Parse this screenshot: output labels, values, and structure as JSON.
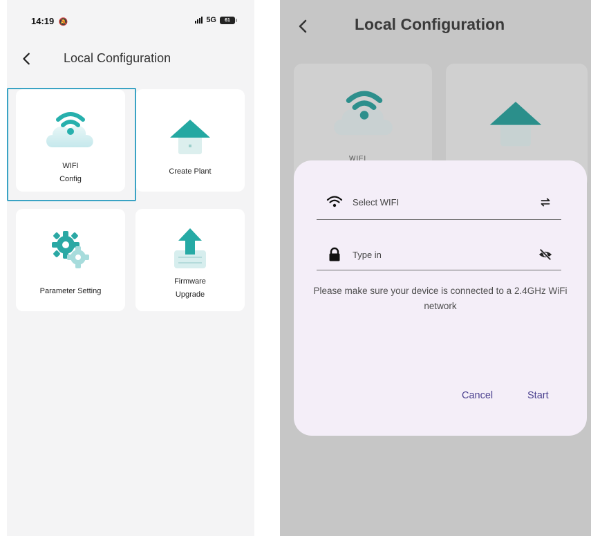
{
  "left_screen": {
    "status_bar": {
      "time": "14:19",
      "time_icon": "bell-off-icon",
      "network": "5G",
      "battery": "61"
    },
    "header": {
      "back_icon": "chevron-left-icon",
      "title": "Local Configuration"
    },
    "tiles": [
      {
        "id": "wifi-config",
        "line1": "WIFI",
        "line2": "Config",
        "icon": "wifi-cloud-icon",
        "highlighted": true
      },
      {
        "id": "create-plant",
        "line1": "Create Plant",
        "line2": "",
        "icon": "house-icon"
      },
      {
        "id": "parameter-setting",
        "line1": "Parameter Setting",
        "line2": "",
        "icon": "gear-icon"
      },
      {
        "id": "firmware-upgrade",
        "line1": "Firmware",
        "line2": "Upgrade",
        "icon": "upload-arrow-icon"
      }
    ]
  },
  "right_screen": {
    "header": {
      "back_icon": "chevron-left-icon",
      "title": "Local Configuration"
    },
    "background_label": "WIFI",
    "dialog": {
      "wifi_field": {
        "placeholder": "Select WIFI",
        "icon": "wifi-icon",
        "action_icon": "swap-arrows-icon"
      },
      "password_field": {
        "placeholder": "Type in",
        "icon": "lock-icon",
        "action_icon": "eye-off-icon"
      },
      "note": "Please make sure your device is connected to a 2.4GHz WiFi network",
      "cancel_label": "Cancel",
      "start_label": "Start"
    }
  },
  "colors": {
    "accent_teal": "#2bb3b0",
    "highlight_border": "#3aa3c4",
    "dialog_background": "#f4eef8",
    "dialog_button_text": "#4c4290",
    "overlay_grey": "#c6c6c6"
  }
}
